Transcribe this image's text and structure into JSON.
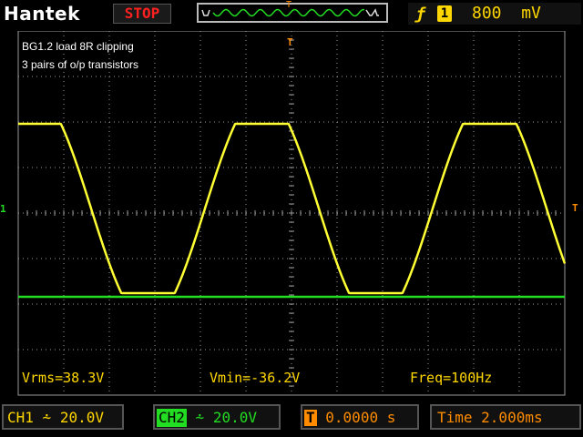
{
  "header": {
    "brand": "Hantek",
    "run_state": "STOP",
    "trigger_marker": "T",
    "trigger_source": "1",
    "trigger_level": "800",
    "trigger_unit": "mV"
  },
  "annotations": {
    "line1": "BG1.2 load 8R clipping",
    "line2": "3 pairs of o/p transistors"
  },
  "measurements": {
    "vrms": "Vrms=38.3V",
    "vmin": "Vmin=-36.2V",
    "freq": "Freq=100Hz"
  },
  "footer": {
    "ch1_label": "CH1",
    "ch1_scale": "20.0V",
    "ch2_label": "CH2",
    "ch2_scale": "20.0V",
    "hpos_label": "T",
    "hpos_value": "0.0000 s",
    "timebase": "Time 2.000ms"
  },
  "markers": {
    "ch1_left": "1",
    "trigger_right": "T",
    "trigger_pos": "T"
  },
  "colors": {
    "ch1": "#ffff33",
    "ch2": "#22dd22",
    "trigger": "#ff8c00",
    "grid": "#9a9a9a"
  }
}
